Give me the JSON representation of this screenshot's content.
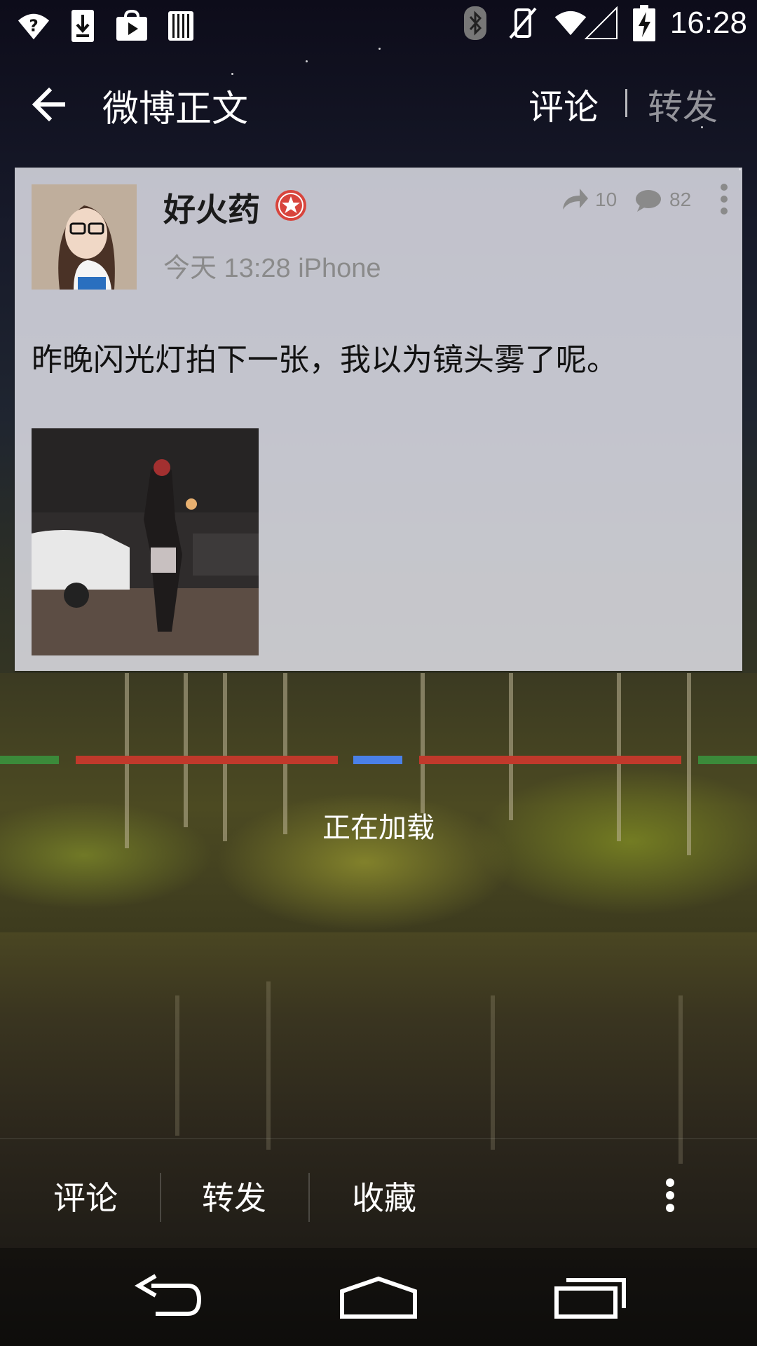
{
  "status_bar": {
    "time": "16:28",
    "left_icons": [
      "wifi-question-icon",
      "download-icon",
      "play-store-icon",
      "barcode-icon"
    ],
    "right_icons": [
      "bluetooth-icon",
      "vibrate-off-icon",
      "wifi-icon",
      "signal-icon",
      "battery-charging-icon"
    ]
  },
  "action_bar": {
    "title": "微博正文",
    "tabs": [
      {
        "label": "评论",
        "active": true
      },
      {
        "label": "转发",
        "active": false
      }
    ]
  },
  "post": {
    "username": "好火药",
    "meta": "今天 13:28 iPhone",
    "repost_count": "10",
    "comment_count": "82",
    "text": "昨晚闪光灯拍下一张，我以为镜头雾了呢。"
  },
  "loading": {
    "text": "正在加载",
    "colors": [
      "#3b8a3a",
      "#c0392b",
      "#4a80e8",
      "#c0392b",
      "#3b8a3a"
    ]
  },
  "bottom_toolbar": {
    "comment_label": "评论",
    "repost_label": "转发",
    "favorite_label": "收藏"
  },
  "nav_bar": {
    "buttons": [
      "back-nav-icon",
      "home-nav-icon",
      "recents-nav-icon"
    ]
  }
}
